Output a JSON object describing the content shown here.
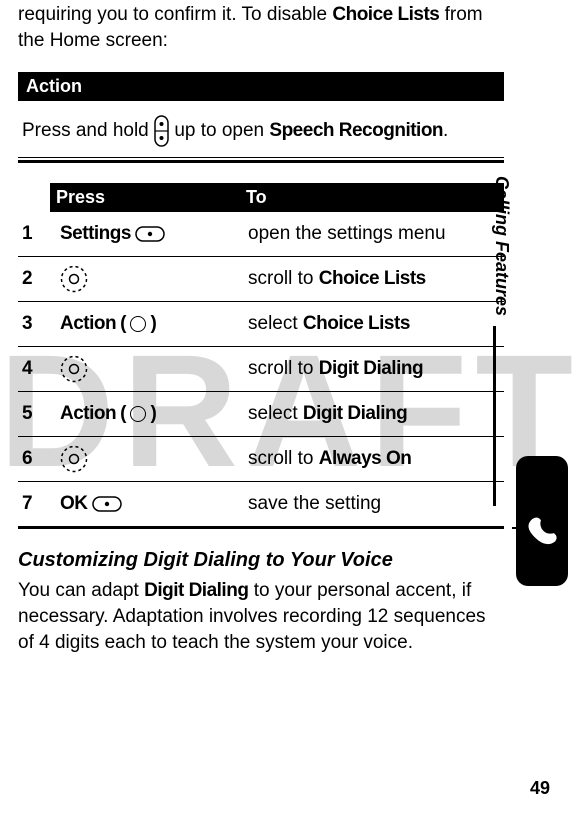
{
  "watermark": "DRAFT",
  "intro": {
    "prefix": "requiring you to confirm it. To disable ",
    "bold1": "Choice Lists",
    "mid": " from the Home screen:"
  },
  "action": {
    "heading": "Action",
    "body_pre": "Press and hold ",
    "body_mid": " up to open ",
    "body_bold": "Speech Recognition",
    "body_end": "."
  },
  "table": {
    "head_press": "Press",
    "head_to": "To",
    "rows": [
      {
        "num": "1",
        "press_plain": "Settings",
        "press_icon": "soft-key",
        "to_pre": "open the settings menu"
      },
      {
        "num": "2",
        "press_icon": "dpad",
        "to_pre": "scroll to ",
        "to_bold": "Choice Lists"
      },
      {
        "num": "3",
        "press_plain": "Action",
        "press_paren": "circle",
        "to_pre": "select ",
        "to_bold": "Choice Lists"
      },
      {
        "num": "4",
        "press_icon": "dpad",
        "to_pre": "scroll to ",
        "to_bold": "Digit Dialing"
      },
      {
        "num": "5",
        "press_plain": "Action",
        "press_paren": "circle",
        "to_pre": "select ",
        "to_bold": "Digit Dialing"
      },
      {
        "num": "6",
        "press_icon": "dpad",
        "to_pre": "scroll to ",
        "to_bold": "Always On"
      },
      {
        "num": "7",
        "press_plain": "OK",
        "press_icon": "soft-key",
        "to_pre": "save the setting"
      }
    ]
  },
  "section": {
    "heading": "Customizing Digit Dialing to Your Voice",
    "body_pre": "You can adapt ",
    "body_bold": "Digit Dialing",
    "body_rest": " to your personal accent, if necessary. Adaptation involves recording 12 sequences of 4 digits each to teach the system your voice."
  },
  "sidebar": {
    "label": "Calling Features"
  },
  "page_number": "49"
}
